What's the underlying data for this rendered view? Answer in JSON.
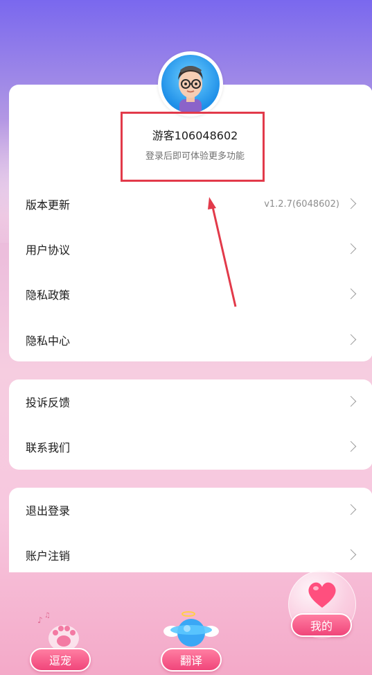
{
  "profile": {
    "username": "游客106048602",
    "subtitle": "登录后即可体验更多功能"
  },
  "group1": [
    {
      "label": "版本更新",
      "value": "v1.2.7(6048602)"
    },
    {
      "label": "用户协议"
    },
    {
      "label": "隐私政策"
    },
    {
      "label": "隐私中心"
    }
  ],
  "group2": [
    {
      "label": "投诉反馈"
    },
    {
      "label": "联系我们"
    }
  ],
  "group3": [
    {
      "label": "退出登录"
    },
    {
      "label": "账户注销"
    }
  ],
  "tabbar": {
    "tab1": "逗宠",
    "tab2": "翻译",
    "tab3": "我的"
  },
  "colors": {
    "accent": "#f0457a",
    "highlight_border": "#e23a4a"
  },
  "icons": [
    "chevron-right-icon",
    "paw-icon",
    "planet-icon",
    "heart-icon",
    "avatar-icon"
  ]
}
